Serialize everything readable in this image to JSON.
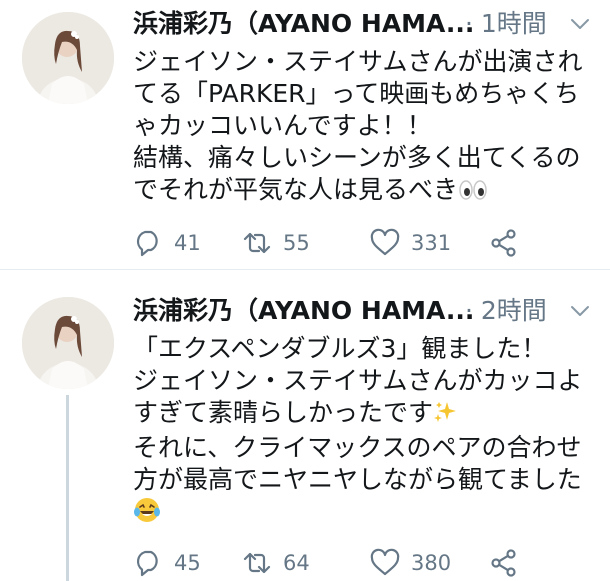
{
  "tweets": [
    {
      "author_name": "浜浦彩乃（AYANO HAMA...",
      "time": "· 1時間",
      "text": "ジェイソン・ステイサムさんが出演されてる「PARKER」って映画もめちゃくちゃカッコいいんですよ！！\n結構、痛々しいシーンが多く出てくるのでそれが平気な人は見るべき",
      "emoji": "eyes",
      "reply_count": "41",
      "retweet_count": "55",
      "like_count": "331"
    },
    {
      "author_name": "浜浦彩乃（AYANO HAMA...",
      "time": "· 2時間",
      "text": "「エクスペンダブルズ3」観ました！\nジェイソン・ステイサムさんがカッコよすぎて素晴らしかったです",
      "text_after": "それに、クライマックスのペアの合わせ方が最高でニヤニヤしながら観てました",
      "emoji_inline": "sparkles",
      "emoji_end": "laughing-with-tears",
      "reply_count": "45",
      "retweet_count": "64",
      "like_count": "380"
    }
  ],
  "colors": {
    "text": "#14171a",
    "secondary": "#657786",
    "divider": "#e6ecf0",
    "thread_line": "#ccd6dd"
  }
}
